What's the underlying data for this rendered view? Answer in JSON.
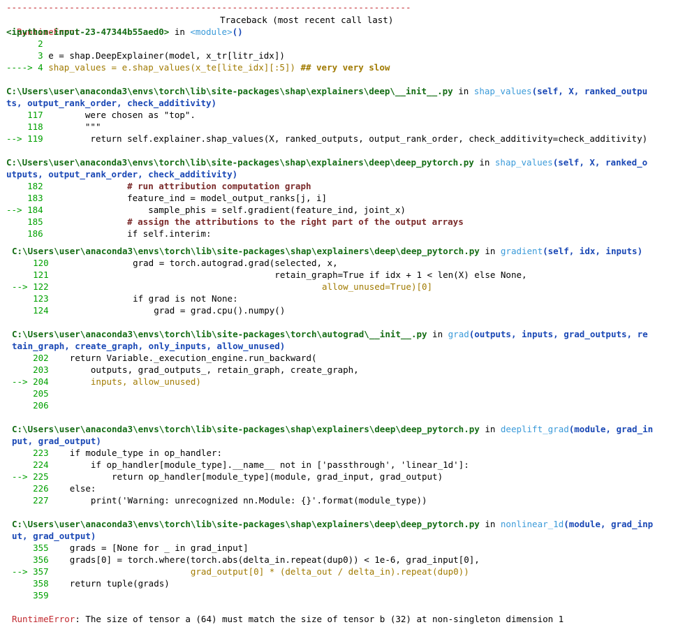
{
  "traceback": {
    "separator": "-----------------------------------------------------------------------------",
    "header": {
      "error_type": "RuntimeError",
      "title": "Traceback (most recent call last)"
    },
    "input_frame": {
      "location": "<ipython-input-23-47344b55aed0>",
      "in_word": " in ",
      "func": "<module>",
      "args": "()",
      "lines": [
        {
          "arrow": "      ",
          "num": "2",
          "code": ""
        },
        {
          "arrow": "      ",
          "num": "3",
          "code": " e = shap.DeepExplainer(model, x_tr[litr_idx])"
        },
        {
          "arrow": "----> ",
          "num": "4",
          "code": " shap_values = e.shap_values(x_te[lite_idx][:5])",
          "comment": " ## very very slow"
        }
      ]
    },
    "frames": [
      {
        "path": "C:\\Users\\user\\anaconda3\\envs\\torch\\lib\\site-packages\\shap\\explainers\\deep\\__init__.py",
        "func": "shap_values",
        "sig1": "(self, X, ranked_outpu",
        "sig2": "ts, output_rank_order, check_additivity)",
        "lines": [
          {
            "arrow": "    ",
            "num": "117",
            "code": "        were chosen as \"top\"."
          },
          {
            "arrow": "    ",
            "num": "118",
            "code": "        \"\"\""
          },
          {
            "arrow": "--> ",
            "num": "119",
            "code": "         return self.explainer.shap_values(X, ranked_outputs, output_rank_order, check_additivity=check_additivity)"
          }
        ]
      },
      {
        "path": "C:\\Users\\user\\anaconda3\\envs\\torch\\lib\\site-packages\\shap\\explainers\\deep\\deep_pytorch.py",
        "func": "shap_values",
        "sig1": "(self, X, ranked_o",
        "sig2": "utputs, output_rank_order, check_additivity)",
        "lines": [
          {
            "arrow": "    ",
            "num": "182",
            "code": "                # run attribution computation graph"
          },
          {
            "arrow": "    ",
            "num": "183",
            "code": "                feature_ind = model_output_ranks[j, i]"
          },
          {
            "arrow": "--> ",
            "num": "184",
            "code": "                    sample_phis = self.gradient(feature_ind, joint_x)"
          },
          {
            "arrow": "    ",
            "num": "185",
            "code": "                # assign the attributions to the right part of the output arrays"
          },
          {
            "arrow": "    ",
            "num": "186",
            "code": "                if self.interim:"
          }
        ]
      },
      {
        "path": "C:\\Users\\user\\anaconda3\\envs\\torch\\lib\\site-packages\\shap\\explainers\\deep\\deep_pytorch.py",
        "func": "gradient",
        "sig1": "(self, idx, inputs)",
        "sig2": "",
        "lines": [
          {
            "arrow": "    ",
            "num": "120",
            "code": "                grad = torch.autograd.grad(selected, x,"
          },
          {
            "arrow": "    ",
            "num": "121",
            "code": "                                           retain_graph=True if idx + 1 < len(X) else None,"
          },
          {
            "arrow": "--> ",
            "num": "122",
            "code": "                                                    allow_unused=True)[0]"
          },
          {
            "arrow": "    ",
            "num": "123",
            "code": "                if grad is not None:"
          },
          {
            "arrow": "    ",
            "num": "124",
            "code": "                    grad = grad.cpu().numpy()"
          }
        ]
      },
      {
        "path": "C:\\Users\\user\\anaconda3\\envs\\torch\\lib\\site-packages\\torch\\autograd\\__init__.py",
        "func": "grad",
        "sig1": "(outputs, inputs, grad_outputs, re",
        "sig2": "tain_graph, create_graph, only_inputs, allow_unused)",
        "lines": [
          {
            "arrow": "    ",
            "num": "202",
            "code": "    return Variable._execution_engine.run_backward("
          },
          {
            "arrow": "    ",
            "num": "203",
            "code": "        outputs, grad_outputs_, retain_graph, create_graph,"
          },
          {
            "arrow": "--> ",
            "num": "204",
            "code": "        inputs, allow_unused)"
          },
          {
            "arrow": "    ",
            "num": "205",
            "code": ""
          },
          {
            "arrow": "    ",
            "num": "206",
            "code": ""
          }
        ]
      },
      {
        "path": "C:\\Users\\user\\anaconda3\\envs\\torch\\lib\\site-packages\\shap\\explainers\\deep\\deep_pytorch.py",
        "func": "deeplift_grad",
        "sig1": "(module, grad_in",
        "sig2": "put, grad_output)",
        "lines": [
          {
            "arrow": "    ",
            "num": "223",
            "code": "    if module_type in op_handler:"
          },
          {
            "arrow": "    ",
            "num": "224",
            "code": "        if op_handler[module_type].__name__ not in ['passthrough', 'linear_1d']:"
          },
          {
            "arrow": "--> ",
            "num": "225",
            "code": "            return op_handler[module_type](module, grad_input, grad_output)"
          },
          {
            "arrow": "    ",
            "num": "226",
            "code": "    else:"
          },
          {
            "arrow": "    ",
            "num": "227",
            "code": "        print('Warning: unrecognized nn.Module: {}'.format(module_type))"
          }
        ]
      },
      {
        "path": "C:\\Users\\user\\anaconda3\\envs\\torch\\lib\\site-packages\\shap\\explainers\\deep\\deep_pytorch.py",
        "func": "nonlinear_1d",
        "sig1": "(module, grad_inp",
        "sig2": "ut, grad_output)",
        "lines": [
          {
            "arrow": "    ",
            "num": "355",
            "code": "    grads = [None for _ in grad_input]"
          },
          {
            "arrow": "    ",
            "num": "356",
            "code": "    grads[0] = torch.where(torch.abs(delta_in.repeat(dup0)) < 1e-6, grad_input[0],"
          },
          {
            "arrow": "--> ",
            "num": "357",
            "code": "                           grad_output[0] * (delta_out / delta_in).repeat(dup0))"
          },
          {
            "arrow": "    ",
            "num": "358",
            "code": "    return tuple(grads)"
          },
          {
            "arrow": "    ",
            "num": "359",
            "code": ""
          }
        ]
      }
    ],
    "final_error": {
      "type": "RuntimeError",
      "message": ": The size of tensor a (64) must match the size of tensor b (32) at non-singleton dimension 1"
    }
  },
  "colors": {
    "error_red": "#c1272d",
    "path_green": "#146c14",
    "func_cyan": "#3a9ad9",
    "sig_blue": "#1a48b5",
    "linenum_green": "#00a000"
  }
}
